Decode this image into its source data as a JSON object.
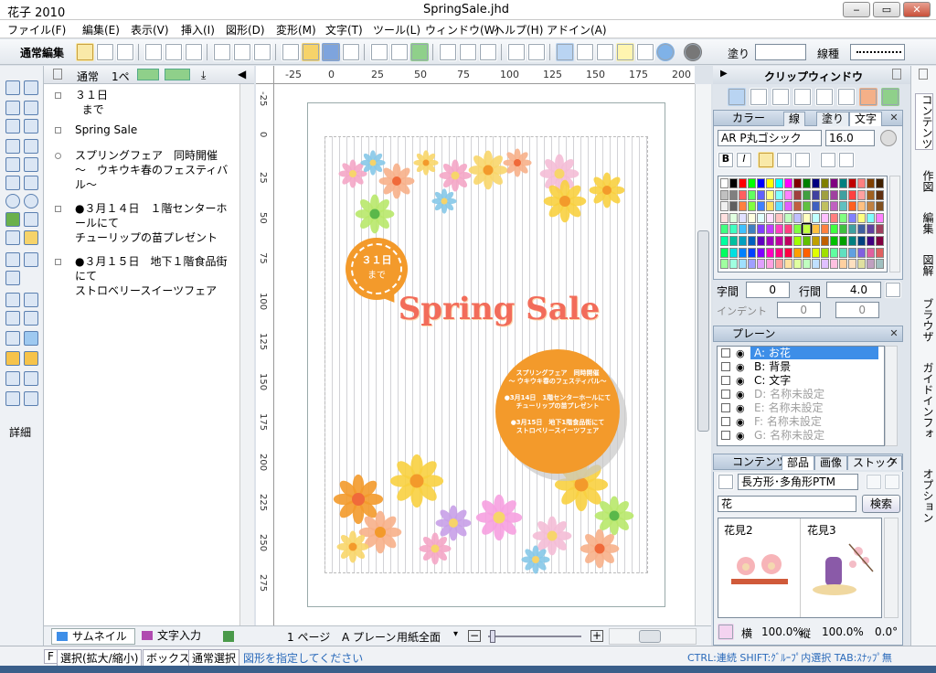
{
  "app": {
    "name": "花子 2010",
    "document": "SpringSale.jhd",
    "minimize": "‒",
    "restore": "▭",
    "close": "✕"
  },
  "menu": [
    "ファイル(F)",
    "編集(E)",
    "表示(V)",
    "挿入(I)",
    "図形(D)",
    "変形(M)",
    "文字(T)",
    "ツール(L)",
    "ウィンドウ(W)",
    "ヘルプ(H)",
    "アドイン(A)"
  ],
  "toolbar": {
    "mode_label": "通常編集",
    "fill_label": "塗り",
    "line_label": "線種"
  },
  "outline": {
    "header": {
      "view_label": "通常",
      "page_label": "1ペ"
    },
    "items": [
      {
        "lines": [
          "３１日",
          "  まで"
        ]
      },
      {
        "lines": [
          "Spring Sale"
        ]
      },
      {
        "lines": [
          "スプリングフェア　同時開催",
          "～　ウキウキ春のフェスティバ",
          "ル～"
        ]
      },
      {
        "lines": [
          "●３月１４日　１階センターホ",
          "ールにて",
          "チューリップの苗プレゼント"
        ]
      },
      {
        "lines": [
          "●３月１５日　地下１階食品街",
          "にて",
          "ストロベリースイーツフェア"
        ]
      }
    ],
    "tab_thumbnail": "サムネイル",
    "tab_text": "文字入力"
  },
  "tools_detail_label": "詳細",
  "ruler": {
    "h": [
      "-25",
      "0",
      "25",
      "50",
      "75",
      "100",
      "125",
      "150",
      "175",
      "200"
    ],
    "v": [
      "-25",
      "0",
      "25",
      "50",
      "75",
      "100",
      "125",
      "150",
      "175",
      "200",
      "225",
      "250",
      "275"
    ]
  },
  "artwork": {
    "badge_line1": "３１日",
    "badge_line2": "まで",
    "title": "Spring Sale",
    "circle_lines": [
      "スプリングフェア　同時開催",
      "～ ウキウキ春のフェスティバル～",
      "",
      "●3月14日　1階センターホールにて",
      "チューリップの苗プレゼント",
      "",
      "●3月15日　地下1階食品街にて",
      "ストロベリースイーツフェア"
    ]
  },
  "canvasbar": {
    "page": "1 ページ",
    "plane": "A プレーン",
    "paper": "用紙全面"
  },
  "clip": {
    "title": "クリップウィンドウ"
  },
  "color_panel": {
    "title": "カラー",
    "tabs": [
      "線",
      "塗り",
      "文字"
    ],
    "font": "AR P丸ゴシック",
    "size": "16.0",
    "char_spacing_label": "字間",
    "char_spacing": "0",
    "line_spacing_label": "行間",
    "line_spacing": "4.0",
    "indent_label": "インデント",
    "indent_a": "0",
    "indent_b": "0"
  },
  "plane_panel": {
    "title": "プレーン",
    "rows": [
      {
        "id": "A:",
        "name": "お花",
        "selected": true,
        "dim": false
      },
      {
        "id": "B:",
        "name": "背景",
        "selected": false,
        "dim": false
      },
      {
        "id": "C:",
        "name": "文字",
        "selected": false,
        "dim": false
      },
      {
        "id": "D:",
        "name": "名称未設定",
        "selected": false,
        "dim": true
      },
      {
        "id": "E:",
        "name": "名称未設定",
        "selected": false,
        "dim": true
      },
      {
        "id": "F:",
        "name": "名称未設定",
        "selected": false,
        "dim": true
      },
      {
        "id": "G:",
        "name": "名称未設定",
        "selected": false,
        "dim": true
      }
    ]
  },
  "contents_panel": {
    "tabs": [
      "コンテンツ",
      "部品",
      "画像",
      "ストック"
    ],
    "category": "長方形･多角形PTM",
    "search_value": "花",
    "search_button": "検索",
    "items": [
      "花見2",
      "花見3"
    ],
    "scale_x_label": "横",
    "scale_x": "100.0%",
    "scale_y_label": "縦",
    "scale_y": "100.0%",
    "angle": "0.0°"
  },
  "vtabs": [
    "コンテンツ",
    "作図",
    "編集",
    "図解",
    "ブラウザ",
    "ガイドインフォ",
    "オプション"
  ],
  "status": {
    "items": [
      "F",
      "選択(拡大/縮小)",
      "ボックス選択",
      "通常選択"
    ],
    "message": "図形を指定してください",
    "hint": "CTRL:連続 SHIFT:ｸﾞﾙｰﾌﾟ内選択 TAB:ｽﾅｯﾌﾟ無"
  },
  "colors": {
    "accent_orange": "#f39a2b",
    "title_red": "#f26c5a",
    "selection_blue": "#3d8ee8"
  }
}
